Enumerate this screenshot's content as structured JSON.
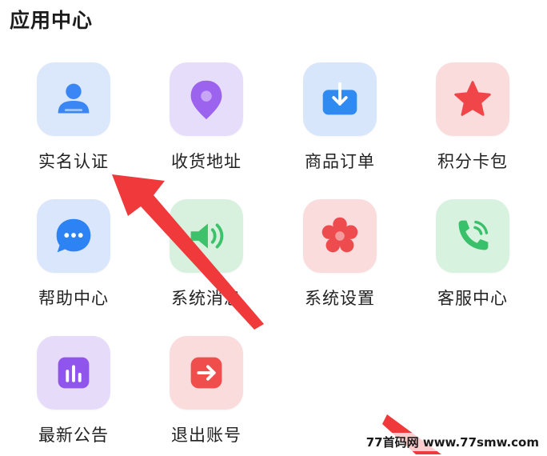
{
  "section": {
    "title": "应用中心"
  },
  "apps": [
    {
      "label": "实名认证",
      "icon": "user-icon",
      "tile_bg": "#dbe7fb",
      "accent": "#3a86f5"
    },
    {
      "label": "收货地址",
      "icon": "location-pin-icon",
      "tile_bg": "#e6ddfa",
      "accent": "#9b63ee"
    },
    {
      "label": "商品订单",
      "icon": "download-box-icon",
      "tile_bg": "#d7e6fb",
      "accent": "#2f8af2"
    },
    {
      "label": "积分卡包",
      "icon": "star-icon",
      "tile_bg": "#fadcdc",
      "accent": "#f0464a"
    },
    {
      "label": "帮助中心",
      "icon": "chat-bubble-icon",
      "tile_bg": "#d9e6fb",
      "accent": "#2d83f3"
    },
    {
      "label": "系统消息",
      "icon": "speaker-icon",
      "tile_bg": "#d8f1df",
      "accent": "#3ec16b"
    },
    {
      "label": "系统设置",
      "icon": "flower-gear-icon",
      "tile_bg": "#fadcdc",
      "accent": "#ee4b4f"
    },
    {
      "label": "客服中心",
      "icon": "phone-call-icon",
      "tile_bg": "#d8f2e0",
      "accent": "#38c06a"
    },
    {
      "label": "最新公告",
      "icon": "bar-chart-icon",
      "tile_bg": "#e6dcfa",
      "accent": "#8f55ec"
    },
    {
      "label": "退出账号",
      "icon": "exit-arrow-icon",
      "tile_bg": "#fadcdc",
      "accent": "#f04d4d"
    }
  ],
  "annotation": {
    "color": "#f0393b"
  },
  "watermark": {
    "text": "77首码网 www.77smw.com"
  }
}
